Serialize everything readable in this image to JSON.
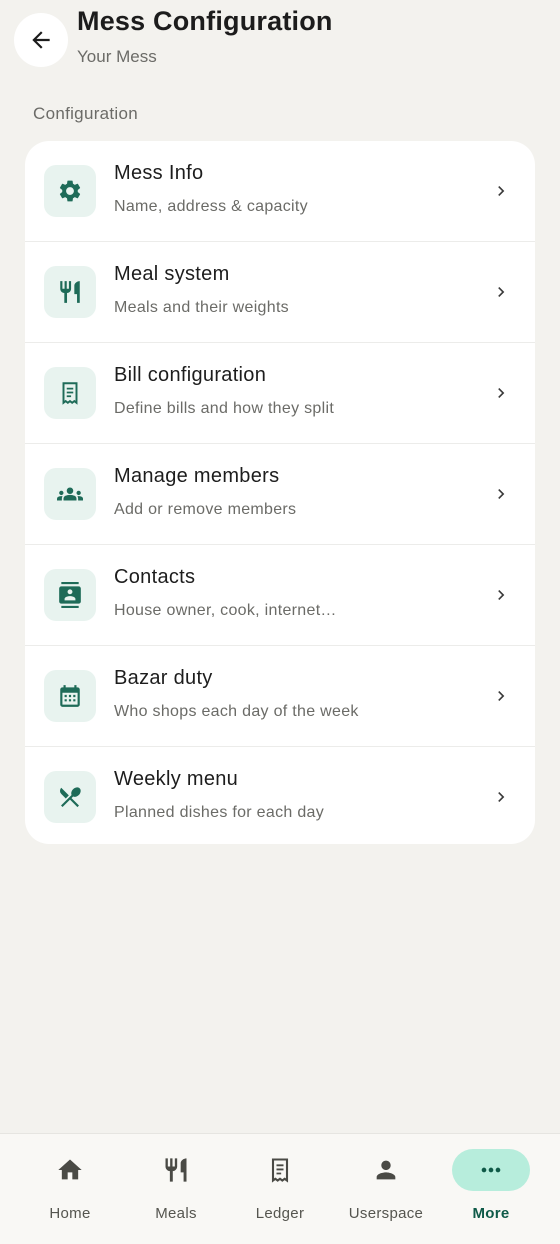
{
  "header": {
    "title": "Mess Configuration",
    "subtitle": "Your Mess"
  },
  "section_label": "Configuration",
  "items": [
    {
      "title": "Mess Info",
      "subtitle": "Name, address & capacity",
      "icon": "gear-icon"
    },
    {
      "title": "Meal system",
      "subtitle": "Meals and their weights",
      "icon": "fork-knife-icon"
    },
    {
      "title": "Bill configuration",
      "subtitle": "Define bills and how they split",
      "icon": "receipt-icon"
    },
    {
      "title": "Manage members",
      "subtitle": "Add or remove members",
      "icon": "group-icon"
    },
    {
      "title": "Contacts",
      "subtitle": "House owner, cook, internet…",
      "icon": "contact-card-icon"
    },
    {
      "title": "Bazar duty",
      "subtitle": "Who shops each day of the week",
      "icon": "calendar-icon"
    },
    {
      "title": "Weekly menu",
      "subtitle": "Planned dishes for each day",
      "icon": "spoon-fork-cross-icon"
    }
  ],
  "nav": {
    "items": [
      {
        "label": "Home",
        "icon": "home-icon",
        "active": false
      },
      {
        "label": "Meals",
        "icon": "fork-knife-icon",
        "active": false
      },
      {
        "label": "Ledger",
        "icon": "receipt-icon",
        "active": false
      },
      {
        "label": "Userspace",
        "icon": "person-icon",
        "active": false
      },
      {
        "label": "More",
        "icon": "more-dots-icon",
        "active": true
      }
    ]
  },
  "colors": {
    "accent": "#1e6b58",
    "icon_bg": "#e8f3ef",
    "active_pill": "#b7eddc",
    "background": "#f3f2ee"
  }
}
